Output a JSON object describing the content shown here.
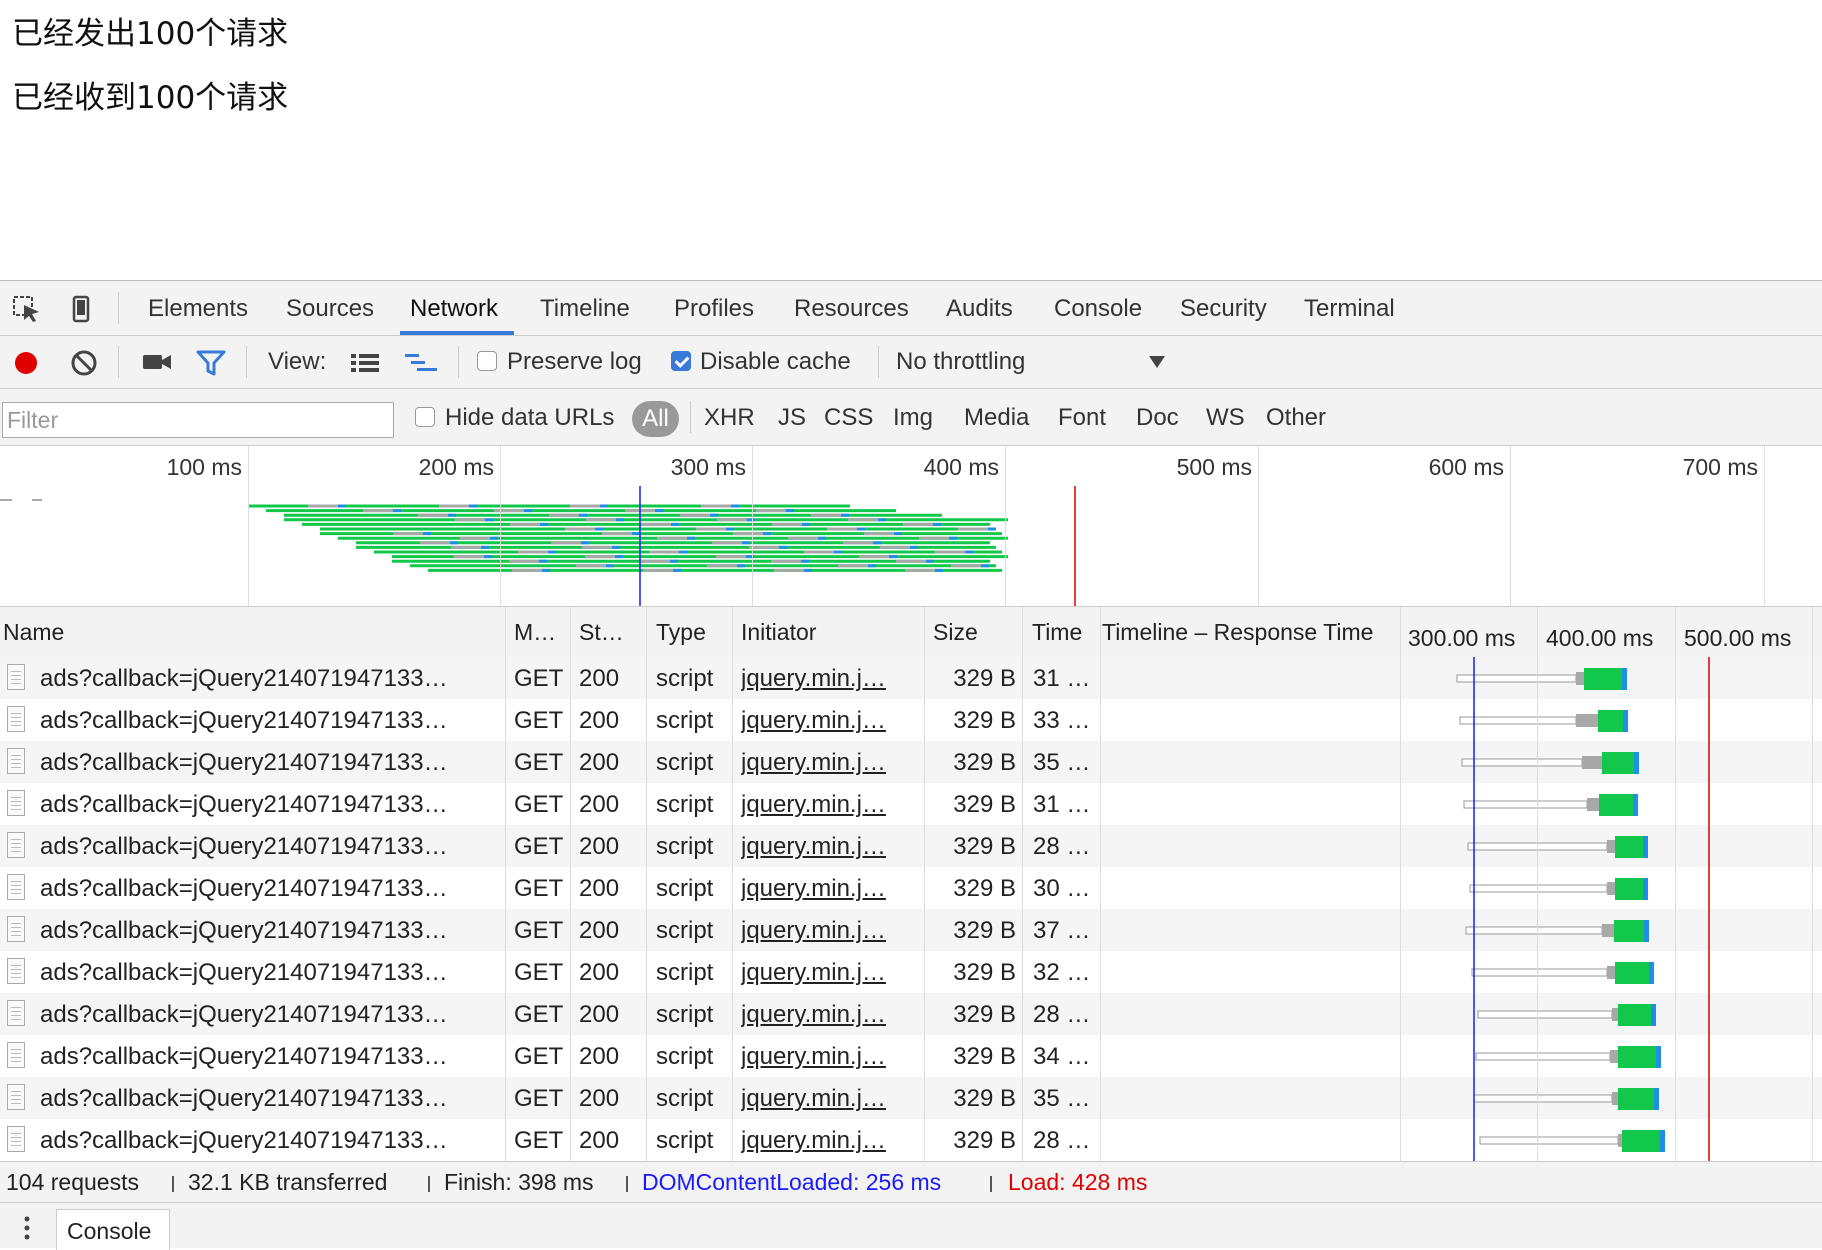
{
  "page": {
    "line1": "已经发出100个请求",
    "line2": "已经收到100个请求"
  },
  "devtools": {
    "icons": [
      "inspect-element-icon",
      "device-mode-icon"
    ],
    "tabs": [
      {
        "label": "Elements"
      },
      {
        "label": "Sources"
      },
      {
        "label": "Network",
        "active": true
      },
      {
        "label": "Timeline"
      },
      {
        "label": "Profiles"
      },
      {
        "label": "Resources"
      },
      {
        "label": "Audits"
      },
      {
        "label": "Console"
      },
      {
        "label": "Security"
      },
      {
        "label": "Terminal"
      }
    ],
    "toolbar": {
      "view_label": "View:",
      "preserve_log_label": "Preserve log",
      "preserve_log_checked": false,
      "disable_cache_label": "Disable cache",
      "disable_cache_checked": true,
      "throttling_value": "No throttling",
      "record_color": "#e00000",
      "filter_active_color": "#3879d9"
    },
    "filterbar": {
      "filter_placeholder": "Filter",
      "hide_data_urls_label": "Hide data URLs",
      "types": [
        "All",
        "XHR",
        "JS",
        "CSS",
        "Img",
        "Media",
        "Font",
        "Doc",
        "WS",
        "Other"
      ],
      "active_type": "All"
    },
    "overview": {
      "ticks": [
        "100 ms",
        "200 ms",
        "300 ms",
        "400 ms",
        "500 ms",
        "600 ms",
        "700 ms"
      ]
    },
    "table": {
      "headers": {
        "name": "Name",
        "method": "M…",
        "status": "St…",
        "type": "Type",
        "initiator": "Initiator",
        "size": "Size",
        "time": "Time",
        "timeline": "Timeline – Response Time"
      },
      "timeline_ticks": [
        "300.00 ms",
        "400.00 ms",
        "500.00 ms"
      ],
      "rows": [
        {
          "name": "ads?callback=jQuery214071947133…",
          "method": "GET",
          "status": "200",
          "type": "script",
          "initiator": "jquery.min.j…",
          "size": "329 B",
          "time": "31 …"
        },
        {
          "name": "ads?callback=jQuery214071947133…",
          "method": "GET",
          "status": "200",
          "type": "script",
          "initiator": "jquery.min.j…",
          "size": "329 B",
          "time": "33 …"
        },
        {
          "name": "ads?callback=jQuery214071947133…",
          "method": "GET",
          "status": "200",
          "type": "script",
          "initiator": "jquery.min.j…",
          "size": "329 B",
          "time": "35 …"
        },
        {
          "name": "ads?callback=jQuery214071947133…",
          "method": "GET",
          "status": "200",
          "type": "script",
          "initiator": "jquery.min.j…",
          "size": "329 B",
          "time": "31 …"
        },
        {
          "name": "ads?callback=jQuery214071947133…",
          "method": "GET",
          "status": "200",
          "type": "script",
          "initiator": "jquery.min.j…",
          "size": "329 B",
          "time": "28 …"
        },
        {
          "name": "ads?callback=jQuery214071947133…",
          "method": "GET",
          "status": "200",
          "type": "script",
          "initiator": "jquery.min.j…",
          "size": "329 B",
          "time": "30 …"
        },
        {
          "name": "ads?callback=jQuery214071947133…",
          "method": "GET",
          "status": "200",
          "type": "script",
          "initiator": "jquery.min.j…",
          "size": "329 B",
          "time": "37 …"
        },
        {
          "name": "ads?callback=jQuery214071947133…",
          "method": "GET",
          "status": "200",
          "type": "script",
          "initiator": "jquery.min.j…",
          "size": "329 B",
          "time": "32 …"
        },
        {
          "name": "ads?callback=jQuery214071947133…",
          "method": "GET",
          "status": "200",
          "type": "script",
          "initiator": "jquery.min.j…",
          "size": "329 B",
          "time": "28 …"
        },
        {
          "name": "ads?callback=jQuery214071947133…",
          "method": "GET",
          "status": "200",
          "type": "script",
          "initiator": "jquery.min.j…",
          "size": "329 B",
          "time": "34 …"
        },
        {
          "name": "ads?callback=jQuery214071947133…",
          "method": "GET",
          "status": "200",
          "type": "script",
          "initiator": "jquery.min.j…",
          "size": "329 B",
          "time": "35 …"
        },
        {
          "name": "ads?callback=jQuery214071947133…",
          "method": "GET",
          "status": "200",
          "type": "script",
          "initiator": "jquery.min.j…",
          "size": "329 B",
          "time": "28 …"
        }
      ]
    },
    "statusbar": {
      "requests": "104 requests",
      "transferred": "32.1 KB transferred",
      "finish": "Finish: 398 ms",
      "dom_content_loaded": "DOMContentLoaded: 256 ms",
      "load": "Load: 428 ms",
      "dcl_color": "#1a1aff",
      "load_color": "#e00000"
    },
    "drawer": {
      "tab_label": "Console"
    },
    "colors": {
      "waiting": "#a8a8a8",
      "receiving": "#12c84a",
      "download": "#1e8ee6",
      "stalled_outline": "#999999"
    }
  }
}
